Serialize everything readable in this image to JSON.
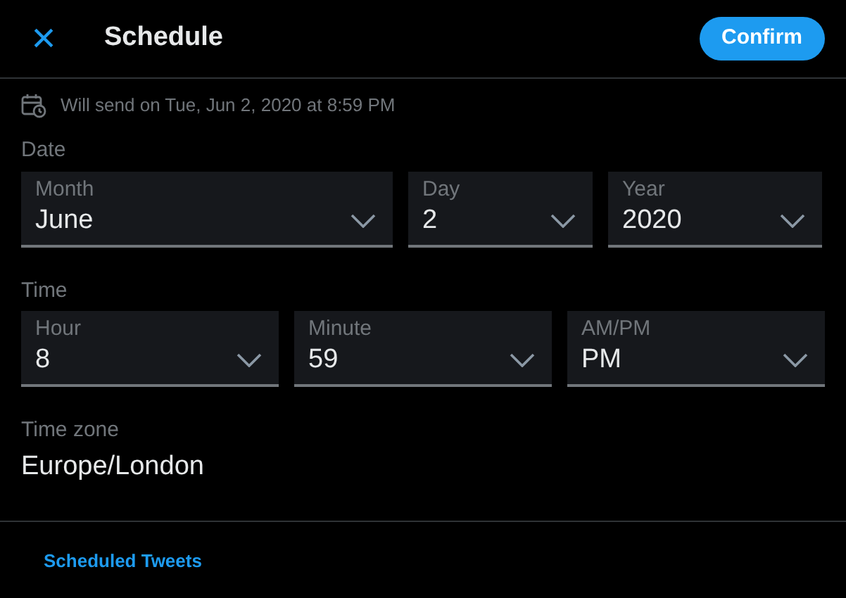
{
  "header": {
    "close": "×",
    "title": "Schedule",
    "confirm": "Confirm"
  },
  "info": "Will send on Tue, Jun 2, 2020 at 8:59 PM",
  "date": {
    "label": "Date",
    "selects": [
      {
        "label": "Month",
        "value": "June"
      },
      {
        "label": "Day",
        "value": "2"
      },
      {
        "label": "Year",
        "value": "2020"
      }
    ]
  },
  "time": {
    "label": "Time",
    "selects": [
      {
        "label": "Hour",
        "value": "8"
      },
      {
        "label": "Minute",
        "value": "59"
      },
      {
        "label": "AM/PM",
        "value": "PM"
      }
    ]
  },
  "time_zone": {
    "label": "Time zone",
    "value": "Europe/London"
  },
  "footer": {
    "link": "Scheduled Tweets"
  }
}
